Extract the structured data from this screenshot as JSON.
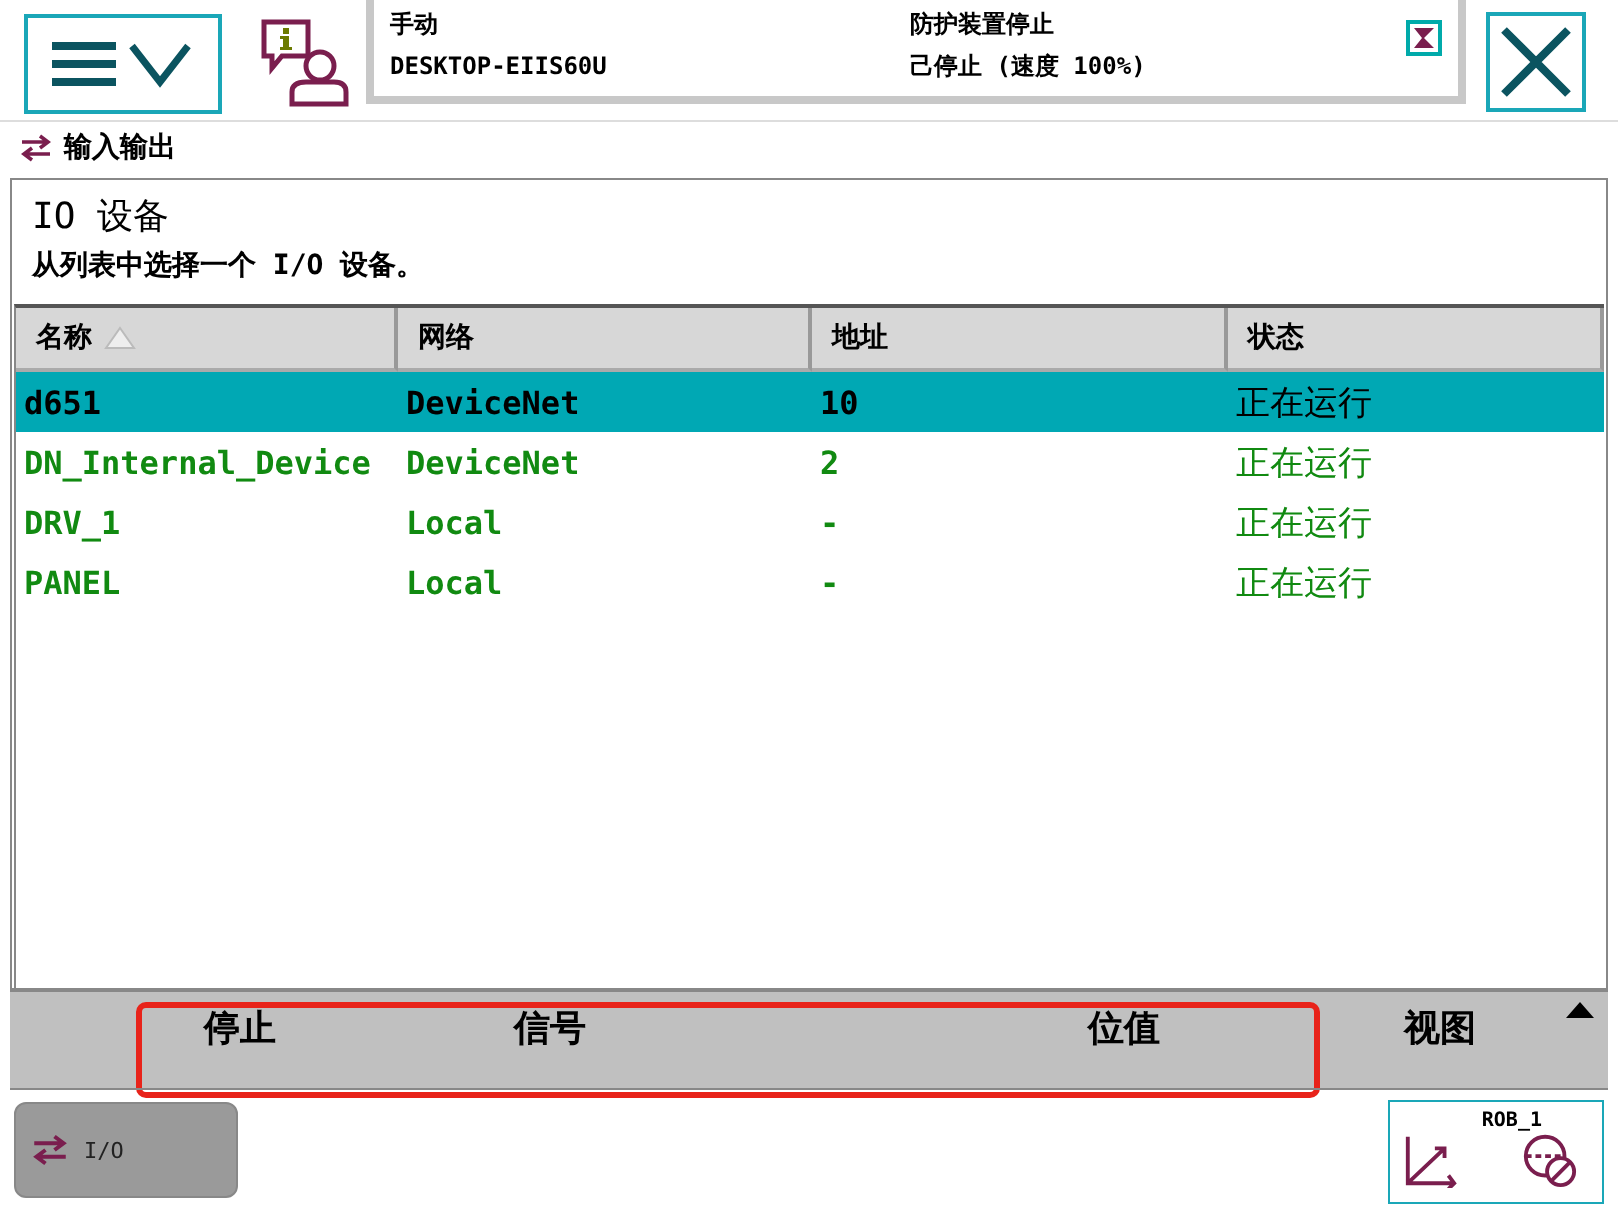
{
  "header": {
    "operating_mode": "手动",
    "system_name": "DESKTOP-EIIS60U",
    "controller_state": "防护装置停止",
    "execution_state": "己停止 (速度 100%)"
  },
  "breadcrumb": "输入输出",
  "panel": {
    "title": "IO 设备",
    "instruction": "从列表中选择一个 I/O 设备。"
  },
  "table": {
    "columns": [
      {
        "label": "名称",
        "sorted": true
      },
      {
        "label": "网络",
        "sorted": false
      },
      {
        "label": "地址",
        "sorted": false
      },
      {
        "label": "状态",
        "sorted": false
      }
    ],
    "rows": [
      {
        "cells": [
          "d651",
          "DeviceNet",
          "10",
          "正在运行"
        ],
        "selected": true
      },
      {
        "cells": [
          "DN_Internal_Device",
          "DeviceNet",
          "2",
          "正在运行"
        ],
        "selected": false
      },
      {
        "cells": [
          "DRV_1",
          "Local",
          "-",
          "正在运行"
        ],
        "selected": false
      },
      {
        "cells": [
          "PANEL",
          "Local",
          "-",
          "正在运行"
        ],
        "selected": false
      }
    ]
  },
  "command_bar": {
    "buttons": [
      "停止",
      "信号",
      "位值",
      "视图"
    ]
  },
  "taskbar": {
    "items": [
      {
        "label": "I/O"
      }
    ]
  },
  "quickset": {
    "label": "ROB_1"
  }
}
